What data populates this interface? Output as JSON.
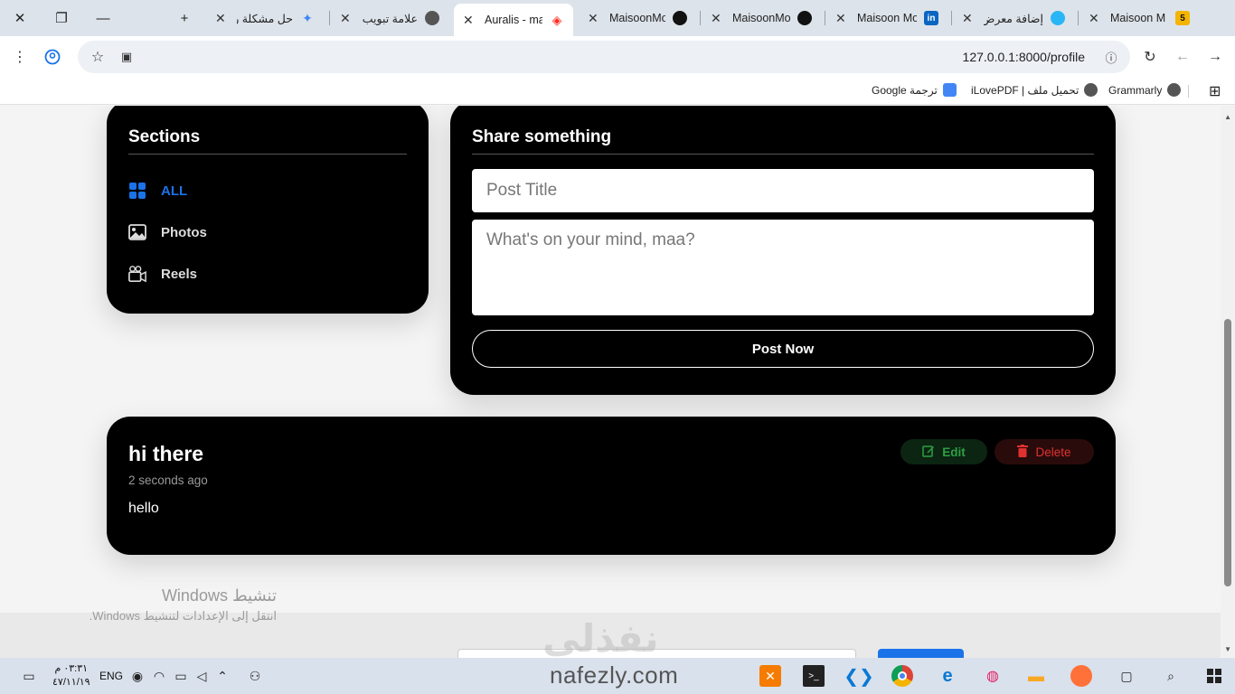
{
  "browser": {
    "tabs": [
      {
        "title": "Maisoon M",
        "icon": "5",
        "icon_color": "#f4b400"
      },
      {
        "title": "إضافة معرض",
        "icon": "",
        "icon_color": "#29b6f6"
      },
      {
        "title": "Maisoon Mo",
        "icon": "in",
        "icon_color": "#0a66c2"
      },
      {
        "title": "MaisoonMo",
        "icon": "",
        "icon_color": "#111111"
      },
      {
        "title": "MaisoonMo",
        "icon": "",
        "icon_color": "#111111"
      },
      {
        "title": "Auralis - ma",
        "icon": "",
        "icon_color": "#ff2d20"
      },
      {
        "title": "علامة تبويب",
        "icon": "",
        "icon_color": "#555555"
      },
      {
        "title": "حل مشكلة را",
        "icon": "",
        "icon_color": "#4285f4"
      }
    ],
    "url": "127.0.0.1:8000/profile",
    "bookmarks": [
      {
        "label": "Grammarly"
      },
      {
        "label": "تحميل ملف | iLovePDF"
      },
      {
        "label": "ترجمة Google"
      }
    ]
  },
  "sections": {
    "title": "Sections",
    "items": [
      {
        "label": "ALL",
        "icon": "grid-icon"
      },
      {
        "label": "Photos",
        "icon": "image-icon"
      },
      {
        "label": "Reels",
        "icon": "video-camera-icon"
      }
    ]
  },
  "share": {
    "title": "Share something",
    "title_placeholder": "Post Title",
    "body_placeholder": "What's on your mind, maa?",
    "button": "Post Now"
  },
  "post": {
    "title": "hi there",
    "time": "2 seconds ago",
    "body": "hello",
    "edit_label": "Edit",
    "delete_label": "Delete"
  },
  "overlay": {
    "activate_title": "تنشيط Windows",
    "activate_sub": "انتقل إلى الإعدادات لتنشيط Windows.",
    "watermark_ar": "نفذلي",
    "watermark_en": "nafezly.com"
  },
  "taskbar": {
    "time": "٠٣:٣١ م",
    "date": "٤٧/١١/١٩",
    "lang": "ENG"
  },
  "colors": {
    "accent": "#1a73e8",
    "card": "#000000",
    "edit": "#2f9e44",
    "delete": "#e03131"
  }
}
